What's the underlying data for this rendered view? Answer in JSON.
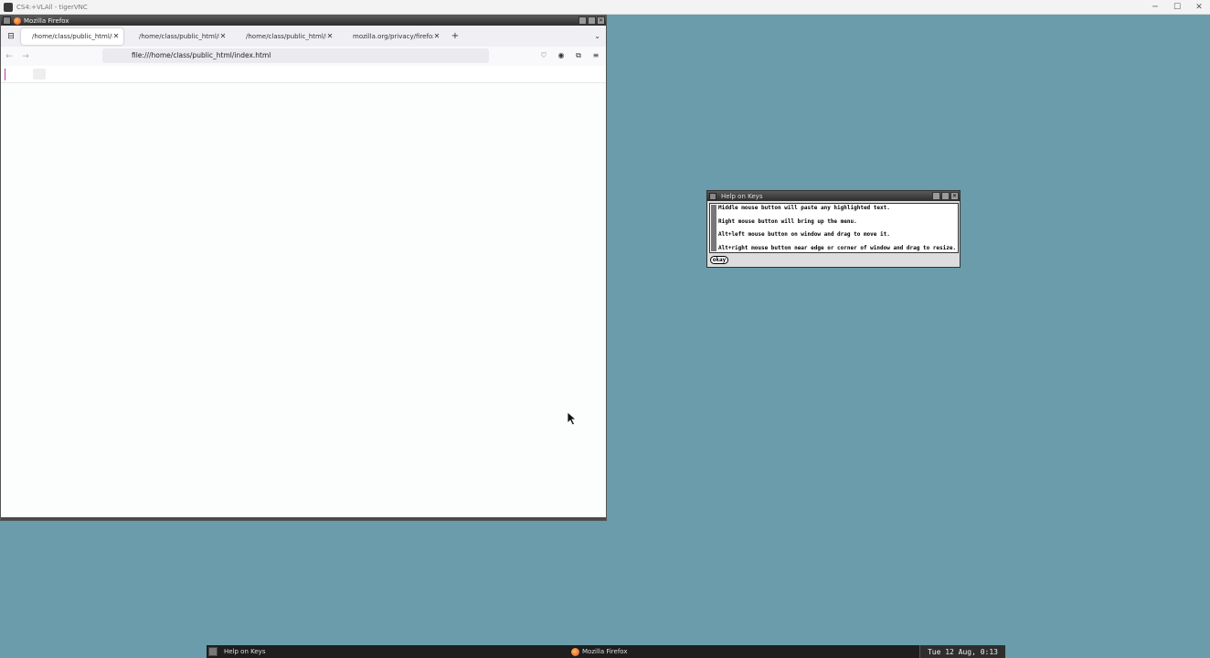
{
  "vnc": {
    "title": "CS4:+VLAll - tigerVNC",
    "controls": [
      "─",
      "☐",
      "✕"
    ]
  },
  "firefox": {
    "window_title": "Mozilla Firefox",
    "tabs": [
      {
        "label": "/home/class/public_html/i",
        "active": true
      },
      {
        "label": "/home/class/public_html/i",
        "active": false
      },
      {
        "label": "/home/class/public_html/i",
        "active": false
      },
      {
        "label": "mozilla.org/privacy/firefox/",
        "active": false
      }
    ],
    "url": "file:///home/class/public_html/index.html"
  },
  "help_window": {
    "title": "Help on Keys",
    "lines": [
      "Middle mouse button will paste any highlighted text.",
      "Right mouse button will bring up the menu.",
      "Alt+left mouse button on window and drag to move it.",
      "Alt+right mouse button near edge or corner of window and drag to resize."
    ],
    "button_label": "okay"
  },
  "taskbar": {
    "items": [
      "Help on Keys",
      "Mozilla Firefox"
    ],
    "clock": "Tue 12 Aug,  0:13"
  }
}
